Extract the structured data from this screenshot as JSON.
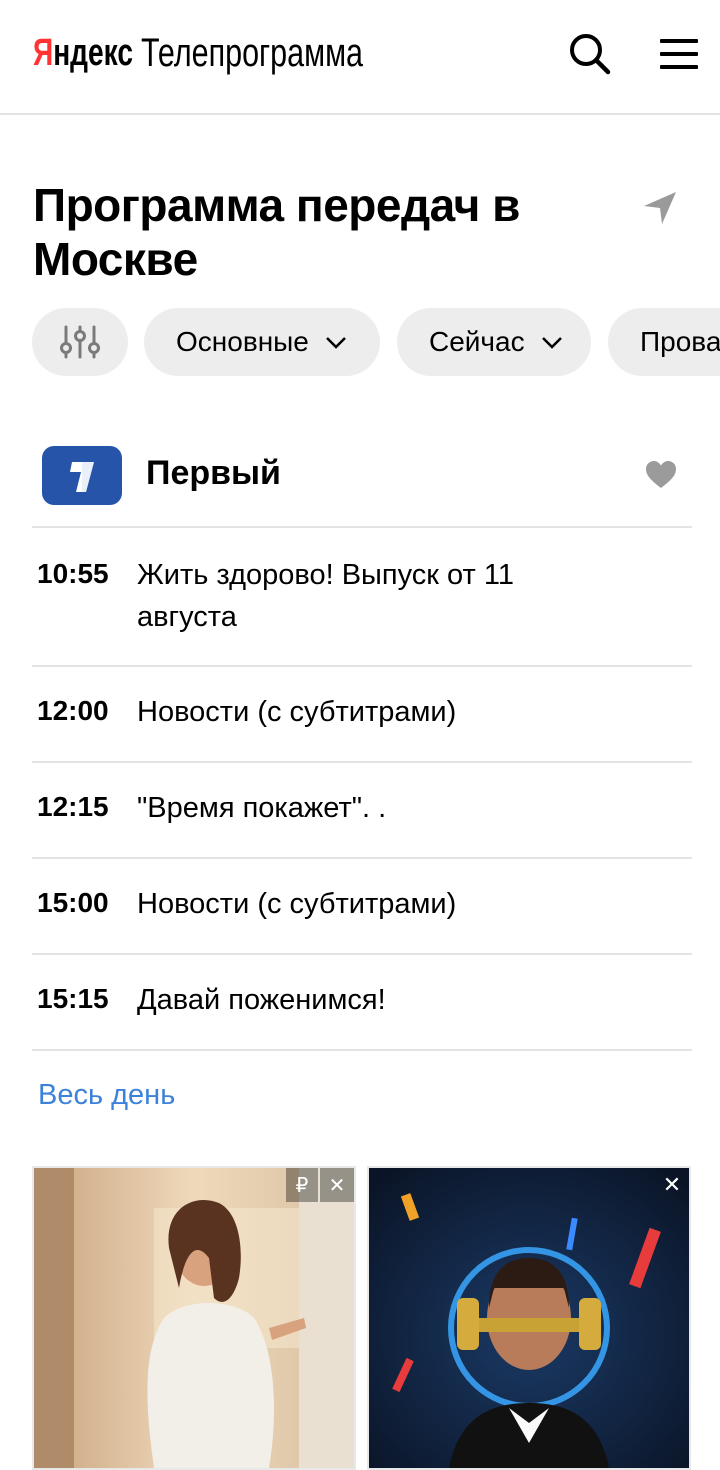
{
  "header": {
    "logo_brand": "Яндекс",
    "logo_service": "Телепрограмма"
  },
  "page": {
    "title": "Программа передач в Москве"
  },
  "filters": {
    "chips": [
      {
        "label": "Основные"
      },
      {
        "label": "Сейчас"
      },
      {
        "label": "Прова"
      }
    ]
  },
  "channel": {
    "name": "Первый",
    "programs": [
      {
        "time": "10:55",
        "title": "Жить здорово! Выпуск от 11 августа"
      },
      {
        "time": "12:00",
        "title": "Новости (с субтитрами)"
      },
      {
        "time": "12:15",
        "title": "\"Время покажет\". ."
      },
      {
        "time": "15:00",
        "title": "Новости (с субтитрами)"
      },
      {
        "time": "15:15",
        "title": "Давай поженимся!"
      }
    ],
    "all_day_link": "Весь день"
  },
  "ads": {
    "left_currency": "₽",
    "close_symbol": "✕"
  },
  "colors": {
    "brand_red": "#ff3333",
    "link_blue": "#3d82d9",
    "chip_bg": "#ededed",
    "channel_logo": "#2554a8"
  }
}
